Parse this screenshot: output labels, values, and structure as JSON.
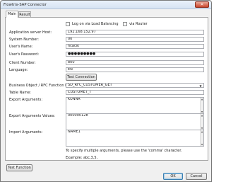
{
  "window": {
    "title": "Flowtrix-SAP Connector",
    "close_glyph": "✕"
  },
  "tabs": [
    {
      "label": "Main"
    },
    {
      "label": "Result"
    }
  ],
  "options": {
    "load_balancing_label": "Log on via Load Balancing",
    "via_router_label": "via Router"
  },
  "form": {
    "app_server_label": "Application server Host:",
    "app_server_value": "192.168.152.97",
    "system_number_label": "System Number:",
    "system_number_value": "00",
    "username_label": "User's Name:",
    "username_value": "ncacik",
    "password_label": "User's Password:",
    "password_value": "●●●●●●●●●",
    "client_label": "Client Number:",
    "client_value": "800",
    "language_label": "Language:",
    "language_value": "EN",
    "test_connection_label": "Test Connection",
    "function_label": "Business Object / RFC Function Name:",
    "function_value": "SD_RFC_CUSTOMER_GET",
    "table_label": "Table Name:",
    "table_value": "CUSTOMET_T",
    "export_args_label": "Export Arguments:",
    "export_args_value": "KUNNR",
    "export_values_label": "Export Arguments Values:",
    "export_values_value": "000000128",
    "import_args_label": "Import Arguments:",
    "import_args_value": "NAME1",
    "hint_text": "To specify multiple arguments, please use the 'comma' character.",
    "example_text": "Example:  abc,3,5,"
  },
  "footer": {
    "test_function_label": "Test Function",
    "ok_label": "OK",
    "cancel_label": "Cancel"
  },
  "icons": {
    "dropdown": "▼",
    "scroll_up": "▲",
    "scroll_down": "▼"
  }
}
